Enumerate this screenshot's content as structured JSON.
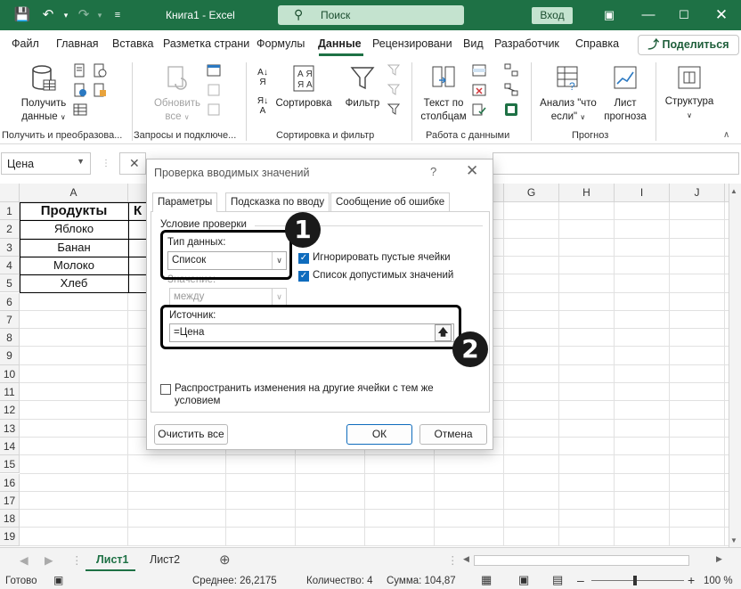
{
  "titlebar": {
    "title": "Книга1 - Excel",
    "search_label": "Поиск",
    "signin_label": "Вход",
    "color": "#1e7145"
  },
  "ribbon_tabs": [
    "Файл",
    "Главная",
    "Вставка",
    "Разметка страни",
    "Формулы",
    "Данные",
    "Рецензировани",
    "Вид",
    "Разработчик",
    "Справка"
  ],
  "active_tab": "Данные",
  "share_label": "Поделиться",
  "ribbon": {
    "get_data_label1": "Получить",
    "get_data_label2": "данные",
    "refresh_label1": "Обновить",
    "refresh_label2": "все",
    "sort_label": "Сортировка",
    "filter_label": "Фильтр",
    "text_to_cols1": "Текст по",
    "text_to_cols2": "столбцам",
    "whatif1": "Анализ \"что",
    "whatif2": "если\"",
    "forecast1": "Лист",
    "forecast2": "прогноза",
    "outline_label": "Структура",
    "groups": [
      "Получить и преобразова...",
      "Запросы и подключе...",
      "Сортировка и фильтр",
      "Работа с данными",
      "Прогноз"
    ]
  },
  "namebox_value": "Цена",
  "grid": {
    "columns": [
      "A",
      "B",
      "C",
      "D",
      "E",
      "F",
      "G",
      "H",
      "I",
      "J"
    ],
    "rows": [
      "1",
      "2",
      "3",
      "4",
      "5",
      "6",
      "7",
      "8",
      "9",
      "10",
      "11",
      "12",
      "13",
      "14",
      "15",
      "16",
      "17",
      "18",
      "19"
    ],
    "header_a1": "Продукты",
    "header_b1": "К",
    "products": [
      "Яблоко",
      "Банан",
      "Молоко",
      "Хлеб"
    ]
  },
  "sheets": {
    "tabs": [
      "Лист1",
      "Лист2"
    ],
    "active": "Лист1"
  },
  "status": {
    "ready": "Готово",
    "average": "Среднее: 26,2175",
    "count": "Количество: 4",
    "sum": "Сумма: 104,87",
    "zoom": "100 %"
  },
  "dialog": {
    "title": "Проверка вводимых значений",
    "help": "?",
    "tabs": [
      "Параметры",
      "Подсказка по вводу",
      "Сообщение об ошибке"
    ],
    "group_label": "Условие проверки",
    "data_type_label": "Тип данных:",
    "data_type_value": "Список",
    "ignore_blank_label": "Игнорировать пустые ячейки",
    "ignore_blank_checked": true,
    "in_cell_dropdown_label": "Список допустимых значений",
    "in_cell_dropdown_checked": true,
    "value_label": "Значение:",
    "value_value": "между",
    "source_label": "Источник:",
    "source_value": "=Цена",
    "apply_all_label1": "Распространить изменения на другие ячейки с тем же",
    "apply_all_label2": "условием",
    "clear_all_label": "Очистить все",
    "ok_label": "ОК",
    "cancel_label": "Отмена"
  },
  "markers": [
    "1",
    "2"
  ]
}
